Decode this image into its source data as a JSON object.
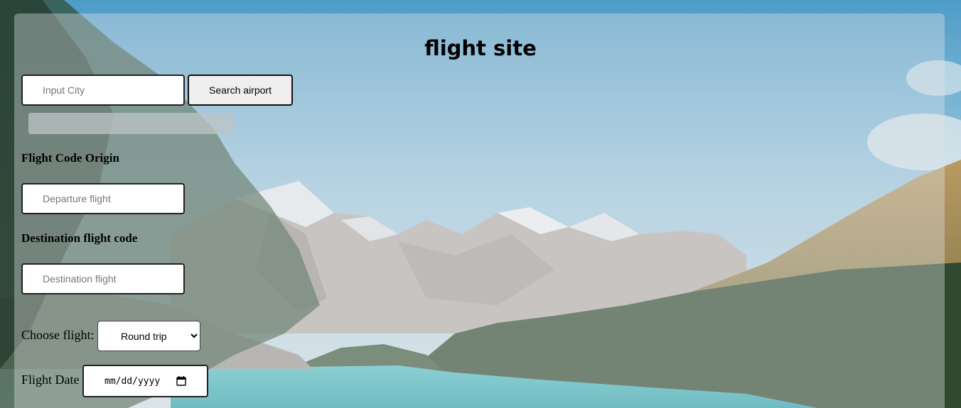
{
  "page": {
    "title": "flight site"
  },
  "search": {
    "city_placeholder": "Input City",
    "button_label": "Search airport"
  },
  "origin": {
    "label": "Flight Code Origin",
    "placeholder": "Departure flight"
  },
  "destination": {
    "label": "Destination flight code",
    "placeholder": "Destination flight"
  },
  "flight_type": {
    "label": "Choose flight:",
    "selected": "Round trip"
  },
  "date": {
    "label": "Flight Date",
    "placeholder": "mm/dd/yyyy",
    "icon": "calendar-icon"
  },
  "colors": {
    "panel_overlay": "rgba(225,230,232,0.38)",
    "sky": "#8fc0dc",
    "lake": "#3fb6bd",
    "forest": "#2d4a2c"
  }
}
